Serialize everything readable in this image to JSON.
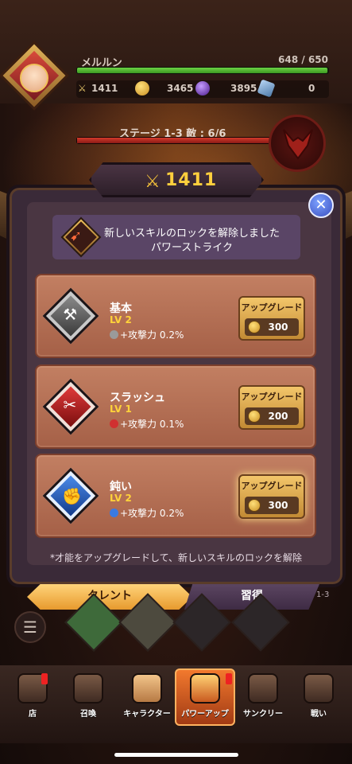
{
  "player": {
    "name": "メルルン",
    "hp": "648 / 650",
    "hp_fraction": 0.997
  },
  "currencies": {
    "power": "1411",
    "gold": "3465",
    "orb": "3895",
    "gem": "0"
  },
  "stage": {
    "label": "ステージ 1-3 敵 : 6/6",
    "progress": 1.0
  },
  "panel": {
    "power_value": "1411",
    "unlock_line1": "新しいスキルのロックを解除しました",
    "unlock_line2": "パワーストライク",
    "close_icon": "close-icon",
    "skills": [
      {
        "name": "基本",
        "level": "LV 2",
        "effect": "+攻撃力 0.2%",
        "upgrade_label": "アップグレード",
        "cost": "300",
        "color": "#6a6a6a"
      },
      {
        "name": "スラッシュ",
        "level": "LV 1",
        "effect": "+攻撃力 0.1%",
        "upgrade_label": "アップグレード",
        "cost": "200",
        "color": "#c42020"
      },
      {
        "name": "鈍い",
        "level": "LV 2",
        "effect": "+攻撃力 0.2%",
        "upgrade_label": "アップグレード",
        "cost": "300",
        "color": "#2f6fd0"
      }
    ],
    "note": "*才能をアップグレードして、新しいスキルのロックを解除",
    "tabs": {
      "talent": "タレント",
      "learn": "習得"
    },
    "side_label": "1-3"
  },
  "nav": [
    {
      "label": "店",
      "icon": "shop-icon"
    },
    {
      "label": "召喚",
      "icon": "summon-icon"
    },
    {
      "label": "キャラクター",
      "icon": "character-icon"
    },
    {
      "label": "パワーアップ",
      "icon": "powerup-icon"
    },
    {
      "label": "サンクリー",
      "icon": "sanctuary-icon"
    },
    {
      "label": "戦い",
      "icon": "battle-icon"
    }
  ]
}
